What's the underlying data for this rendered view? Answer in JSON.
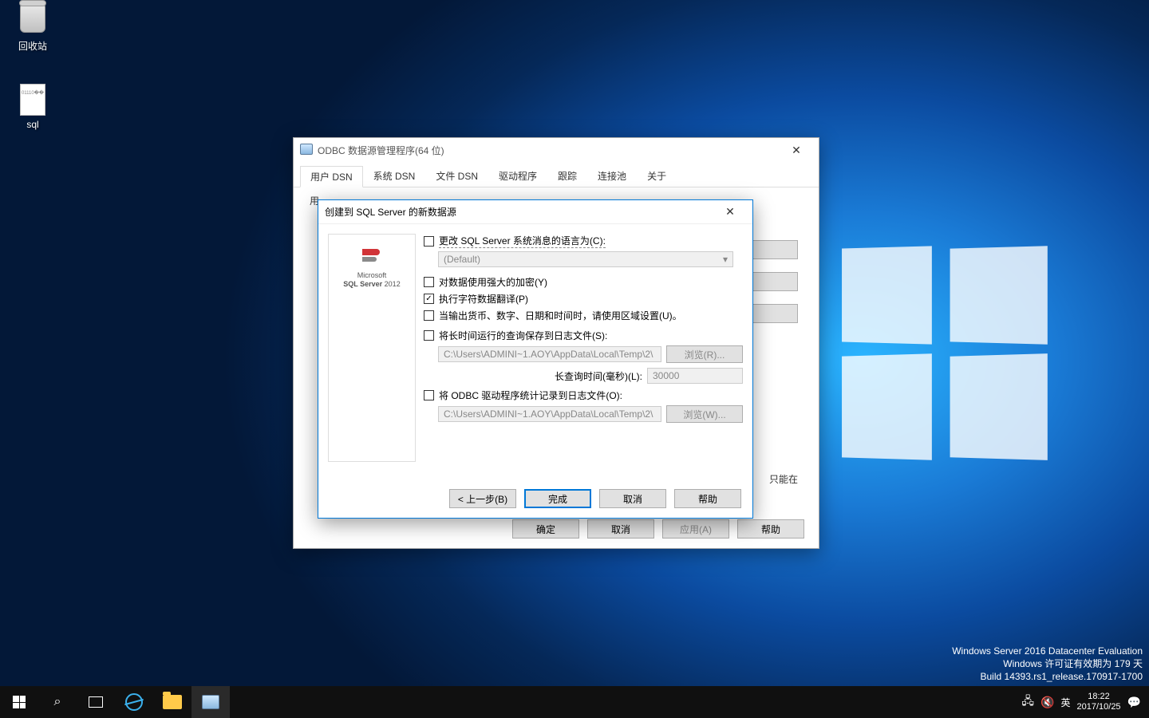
{
  "desktop": {
    "recycle_bin_label": "回收站",
    "sql_label": "sql"
  },
  "watermark": {
    "line1": "Windows Server 2016 Datacenter Evaluation",
    "line2": "Windows 许可证有效期为 179 天",
    "line3": "Build 14393.rs1_release.170917-1700"
  },
  "taskbar": {
    "ime_lang": "英",
    "time": "18:22",
    "date": "2017/10/25"
  },
  "odbc_admin": {
    "title": "ODBC 数据源管理程序(64 位)",
    "tabs": [
      "用户 DSN",
      "系统 DSN",
      "文件 DSN",
      "驱动程序",
      "跟踪",
      "连接池",
      "关于"
    ],
    "body_label_fragment": "用",
    "info_fragment": "只能在",
    "buttons": {
      "ok": "确定",
      "cancel": "取消",
      "apply": "应用(A)",
      "help": "帮助"
    }
  },
  "wizard": {
    "title": "创建到 SQL Server 的新数据源",
    "sidebar_brand_top": "Microsoft",
    "sidebar_brand_main": "SQL Server",
    "sidebar_brand_year": "2012",
    "chk_change_lang": "更改 SQL Server 系统消息的语言为(C):",
    "select_default": "(Default)",
    "chk_strong_encrypt": "对数据使用强大的加密(Y)",
    "chk_char_translate": "执行字符数据翻译(P)",
    "chk_regional": "当输出货币、数字、日期和时间时，请使用区域设置(U)。",
    "chk_save_long_query": "将长时间运行的查询保存到日志文件(S):",
    "path1": "C:\\Users\\ADMINI~1.AOY\\AppData\\Local\\Temp\\2\\",
    "browse1": "浏览(R)...",
    "long_query_label": "长查询时间(毫秒)(L):",
    "long_query_value": "30000",
    "chk_save_stats": "将 ODBC 驱动程序统计记录到日志文件(O):",
    "path2": "C:\\Users\\ADMINI~1.AOY\\AppData\\Local\\Temp\\2\\",
    "browse2": "浏览(W)...",
    "buttons": {
      "back": "< 上一步(B)",
      "finish": "完成",
      "cancel": "取消",
      "help": "帮助"
    }
  }
}
